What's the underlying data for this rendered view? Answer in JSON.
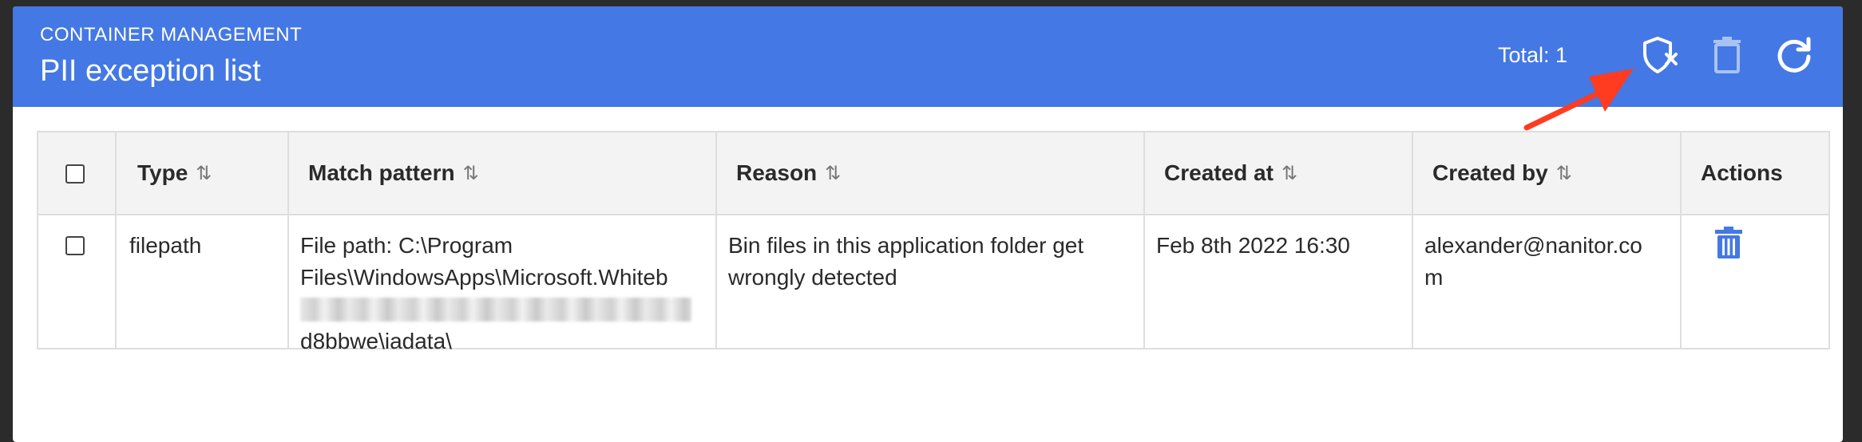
{
  "header": {
    "eyebrow": "CONTAINER MANAGEMENT",
    "title": "PII exception list",
    "total_label": "Total: 1",
    "icons": [
      "shield-x-icon",
      "trash-icon",
      "refresh-icon"
    ]
  },
  "colors": {
    "header_bg": "#4478e4",
    "accent": "#4478e4",
    "arrow": "#ff3b20"
  },
  "table": {
    "columns": [
      {
        "label": "Type",
        "sortable": true
      },
      {
        "label": "Match pattern",
        "sortable": true
      },
      {
        "label": "Reason",
        "sortable": true
      },
      {
        "label": "Created at",
        "sortable": true
      },
      {
        "label": "Created by",
        "sortable": true
      },
      {
        "label": "Actions",
        "sortable": false
      }
    ],
    "sort_glyph": "⇅",
    "rows": [
      {
        "type": "filepath",
        "match_pattern_line1": "File path: C:\\Program",
        "match_pattern_line2": "Files\\WindowsApps\\Microsoft.Whiteb",
        "match_pattern_line4": "d8bbwe\\iadata\\",
        "reason_line1": "Bin files in this application folder get",
        "reason_line2": "wrongly detected",
        "created_at": "Feb 8th 2022 16:30",
        "created_by_line1": "alexander@nanitor.co",
        "created_by_line2": "m"
      }
    ]
  }
}
